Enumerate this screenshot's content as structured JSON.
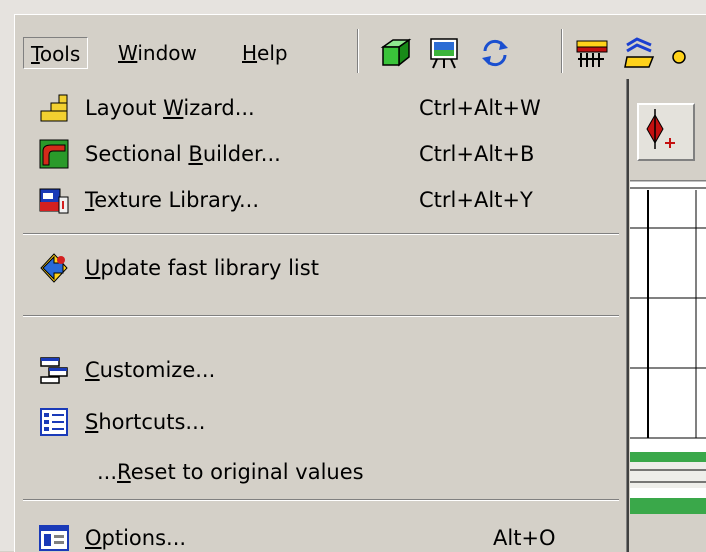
{
  "menubar": {
    "items": [
      {
        "pre": "",
        "acc": "T",
        "post": "ools"
      },
      {
        "pre": "",
        "acc": "W",
        "post": "indow"
      },
      {
        "pre": "",
        "acc": "H",
        "post": "elp"
      }
    ]
  },
  "toolbar": {
    "icons": [
      "3d-box-icon",
      "scene-view-icon",
      "refresh-icon",
      "track-tool-icon",
      "layout-tool-icon"
    ]
  },
  "dropdown": {
    "items": [
      {
        "pre": "Layout ",
        "acc": "W",
        "post": "izard...",
        "shortcut": "Ctrl+Alt+W",
        "icon": "layout-wizard-icon"
      },
      {
        "pre": "Sectional ",
        "acc": "B",
        "post": "uilder...",
        "shortcut": "Ctrl+Alt+B",
        "icon": "sectional-builder-icon"
      },
      {
        "pre": "",
        "acc": "T",
        "post": "exture Library...",
        "shortcut": "Ctrl+Alt+Y",
        "icon": "texture-library-icon"
      },
      {
        "pre": "",
        "acc": "U",
        "post": "pdate fast library list",
        "shortcut": "",
        "icon": "update-library-icon"
      },
      {
        "pre": "",
        "acc": "C",
        "post": "ustomize...",
        "shortcut": "",
        "icon": "customize-icon"
      },
      {
        "pre": "",
        "acc": "S",
        "post": "hortcuts...",
        "shortcut": "",
        "icon": "shortcuts-icon"
      },
      {
        "pre": "...",
        "acc": "R",
        "post": "eset to original values",
        "shortcut": "",
        "icon": ""
      },
      {
        "pre": "",
        "acc": "O",
        "post": "ptions...",
        "shortcut": "Alt+O",
        "icon": "options-icon"
      }
    ]
  },
  "colors": {
    "face": "#d4d0c8",
    "green": "#3aa84a",
    "white": "#ffffff"
  }
}
